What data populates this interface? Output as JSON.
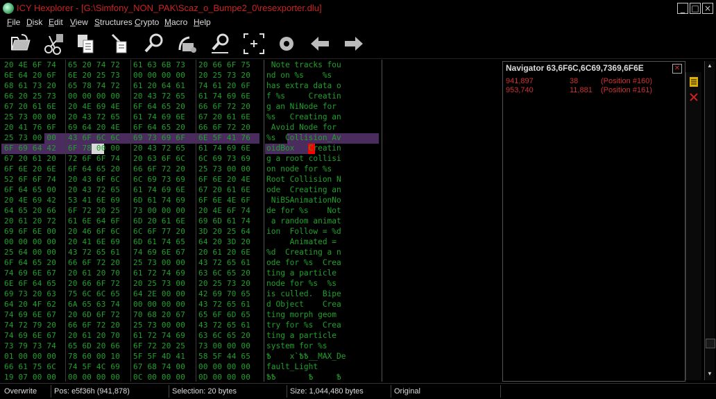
{
  "window": {
    "title": "ICY Hexplorer - [G:\\Simfony_NON_PAK\\Scaz_o_Bumpe2_0\\resexporter.dlu]",
    "controls": [
      "_",
      "□",
      "×"
    ]
  },
  "menu": [
    "File",
    "Disk",
    "Edit",
    "View",
    "Structures",
    "Crypto",
    "Macro",
    "Help"
  ],
  "toolbar": [
    {
      "name": "open-icon"
    },
    {
      "name": "cut-icon"
    },
    {
      "name": "copy-icon"
    },
    {
      "name": "paste-icon"
    },
    {
      "name": "find-icon"
    },
    {
      "name": "replace-icon"
    },
    {
      "name": "find-next-icon"
    },
    {
      "name": "select-block-icon"
    },
    {
      "name": "record-icon"
    },
    {
      "name": "back-arrow-icon"
    },
    {
      "name": "forward-arrow-icon"
    }
  ],
  "hex_rows": [
    [
      "20 4E 6F 74",
      "65 20 74 72",
      "61 63 6B 73",
      "20 66 6F 75"
    ],
    [
      "6E 64 20 6F",
      "6E 20 25 73",
      "00 00 00 00",
      "20 25 73 20"
    ],
    [
      "68 61 73 20",
      "65 78 74 72",
      "61 20 64 61",
      "74 61 20 6F"
    ],
    [
      "66 20 25 73",
      "00 00 00 00",
      "20 43 72 65",
      "61 74 69 6E"
    ],
    [
      "67 20 61 6E",
      "20 4E 69 4E",
      "6F 64 65 20",
      "66 6F 72 20"
    ],
    [
      "25 73 00 00",
      "20 43 72 65",
      "61 74 69 6E",
      "67 20 61 6E"
    ],
    [
      "20 41 76 6F",
      "69 64 20 4E",
      "6F 64 65 20",
      "66 6F 72 20"
    ],
    [
      "25 73 00 00",
      "43 6F 6C 6C",
      "69 73 69 6F",
      "6E 5F 41 76"
    ],
    [
      "6F 69 64 42",
      "6F 78 00 00",
      "20 43 72 65",
      "61 74 69 6E"
    ],
    [
      "67 20 61 20",
      "72 6F 6F 74",
      "20 63 6F 6C",
      "6C 69 73 69"
    ],
    [
      "6F 6E 20 6E",
      "6F 64 65 20",
      "66 6F 72 20",
      "25 73 00 00"
    ],
    [
      "52 6F 6F 74",
      "20 43 6F 6C",
      "6C 69 73 69",
      "6F 6E 20 4E"
    ],
    [
      "6F 64 65 00",
      "20 43 72 65",
      "61 74 69 6E",
      "67 20 61 6E"
    ],
    [
      "20 4E 69 42",
      "53 41 6E 69",
      "6D 61 74 69",
      "6F 6E 4E 6F"
    ],
    [
      "64 65 20 66",
      "6F 72 20 25",
      "73 00 00 00",
      "20 4E 6F 74"
    ],
    [
      "20 61 20 72",
      "61 6E 64 6F",
      "6D 20 61 6E",
      "69 6D 61 74"
    ],
    [
      "69 6F 6E 00",
      "20 46 6F 6C",
      "6C 6F 77 20",
      "3D 20 25 64"
    ],
    [
      "00 00 00 00",
      "20 41 6E 69",
      "6D 61 74 65",
      "64 20 3D 20"
    ],
    [
      "25 64 00 00",
      "43 72 65 61",
      "74 69 6E 67",
      "20 61 20 6E"
    ],
    [
      "6F 64 65 20",
      "66 6F 72 20",
      "25 73 00 00",
      "43 72 65 61"
    ],
    [
      "74 69 6E 67",
      "20 61 20 70",
      "61 72 74 69",
      "63 6C 65 20"
    ],
    [
      "6E 6F 64 65",
      "20 66 6F 72",
      "20 25 73 00",
      "20 25 73 20"
    ],
    [
      "69 73 20 63",
      "75 6C 6C 65",
      "64 2E 00 00",
      "42 69 70 65"
    ],
    [
      "64 20 4F 62",
      "6A 65 63 74",
      "00 00 00 00",
      "43 72 65 61"
    ],
    [
      "74 69 6E 67",
      "20 6D 6F 72",
      "70 68 20 67",
      "65 6F 6D 65"
    ],
    [
      "74 72 79 20",
      "66 6F 72 20",
      "25 73 00 00",
      "43 72 65 61"
    ],
    [
      "74 69 6E 67",
      "20 61 20 70",
      "61 72 74 69",
      "63 6C 65 20"
    ],
    [
      "73 79 73 74",
      "65 6D 20 66",
      "6F 72 20 25",
      "73 00 00 00"
    ],
    [
      "01 00 00 00",
      "78 60 00 10",
      "5F 5F 4D 41",
      "58 5F 44 65"
    ],
    [
      "66 61 75 6C",
      "74 5F 4C 69",
      "67 68 74 00",
      "00 00 00 00"
    ],
    [
      "19 07 00 00",
      "00 00 00 00",
      "0C 00 00 00",
      "0D 00 00 00"
    ]
  ],
  "text_rows": [
    " Note tracks fou",
    "nd on %s    %s ",
    "has extra data o",
    "f %s     Creatin",
    "g an NiNode for ",
    "%s   Creating an",
    " Avoid Node for ",
    "%s  Collision_Av",
    "oidBox   Creatin",
    "g a root collisi",
    "on node for %s  ",
    "Root Collision N",
    "ode  Creating an",
    " NiBSAnimationNo",
    "de for %s    Not",
    " a random animat",
    "ion  Follow = %d",
    "     Animated = ",
    "%d  Creating a n",
    "ode for %s  Crea",
    "ting a particle ",
    "node for %s  %s ",
    "is culled.  Bipe",
    "d Object    Crea",
    "ting morph geom",
    "try for %s  Crea",
    "ting a particle ",
    "system for %s   ",
    "Ѣ    x`ѢѢ__MAX_De",
    "fault_Light     ",
    "ѢѢ       Ѣ     Ѣ"
  ],
  "navigator": {
    "title": "Navigator 63,6F6C,6C69,7369,6F6E",
    "results": [
      {
        "offset": "941,897",
        "len": "38",
        "pos": "(Position #160)"
      },
      {
        "offset": "953,740",
        "len": "11,881",
        "pos": "(Position #161)"
      }
    ]
  },
  "status": {
    "mode": "Overwrite",
    "pos": "Pos: e5f36h (941,878)",
    "selection": "Selection: 20 bytes",
    "size": "Size: 1,044,480 bytes",
    "state": "Original"
  },
  "colors": {
    "accent_red": "#cc2222",
    "hex_green": "#1fa12a",
    "selection": "#4a2d5e"
  }
}
